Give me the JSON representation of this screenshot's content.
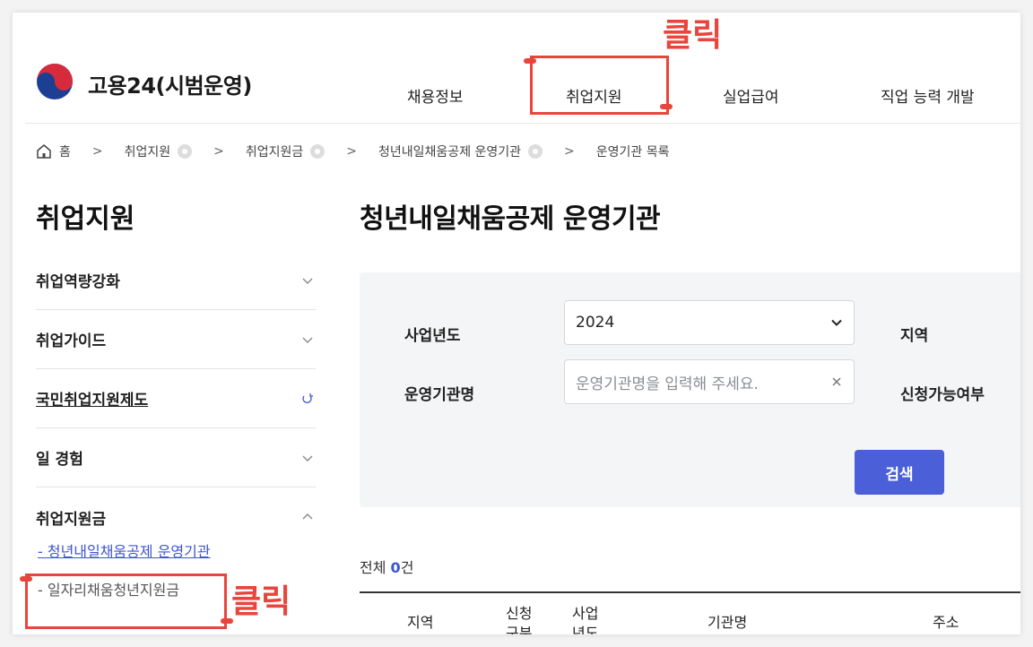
{
  "header": {
    "brand": "고용24(시범운영)",
    "nav": [
      "채용정보",
      "취업지원",
      "실업급여",
      "직업 능력 개발"
    ]
  },
  "breadcrumb": {
    "home": "홈",
    "items": [
      "취업지원",
      "취업지원금",
      "청년내일채움공제 운영기관",
      "운영기관 목록"
    ]
  },
  "sidebar": {
    "title": "취업지원",
    "items": [
      {
        "label": "취업역량강화"
      },
      {
        "label": "취업가이드"
      },
      {
        "label": "국민취업지원제도"
      },
      {
        "label": "일 경험"
      },
      {
        "label": "취업지원금"
      }
    ],
    "sub_items": [
      "- 청년내일채움공제 운영기관",
      "- 일자리채움청년지원금"
    ]
  },
  "main": {
    "title": "청년내일채움공제 운영기관",
    "form": {
      "year_label": "사업년도",
      "year_value": "2024",
      "region_label": "지역",
      "org_label": "운영기관명",
      "org_placeholder": "운영기관명을 입력해 주세요.",
      "apply_label": "신청가능여부",
      "search_button": "검색"
    },
    "total_prefix": "전체",
    "total_count": "0",
    "total_suffix": "건",
    "table_headers": [
      "지역",
      "신청\n구분",
      "사업\n년도",
      "기관명",
      "주소"
    ]
  },
  "annotations": {
    "click_label": "클릭",
    "color": "#e8453c"
  },
  "colors": {
    "accent": "#4a5fd8",
    "link": "#3e55d2"
  }
}
